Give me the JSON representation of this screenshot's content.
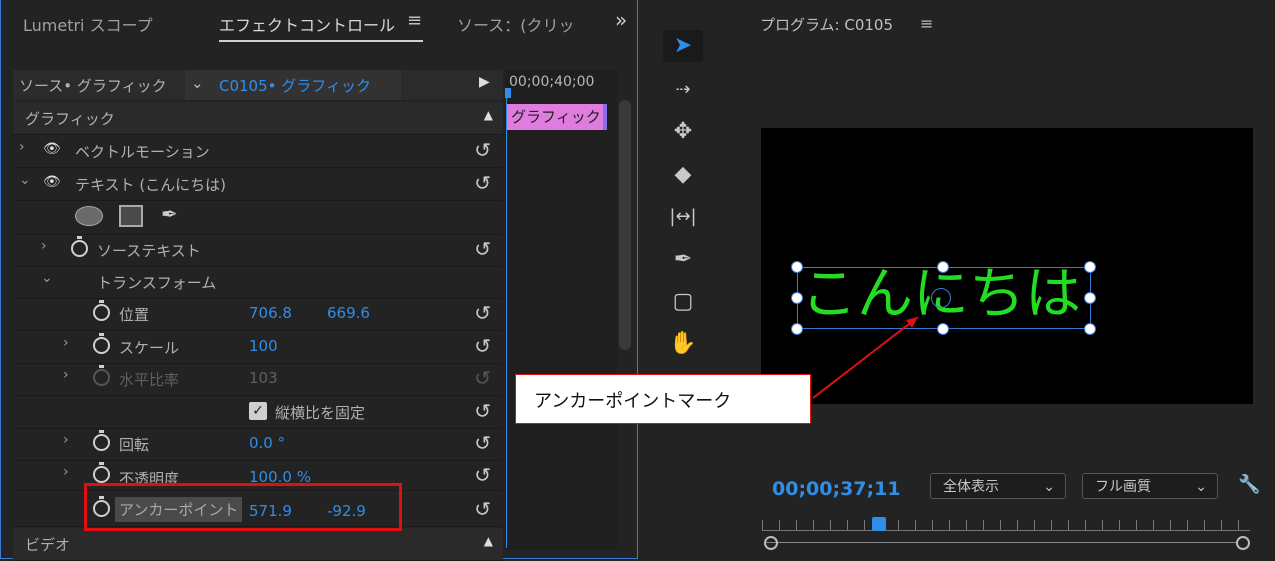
{
  "effect_panel": {
    "tabs": [
      "Lumetri スコープ",
      "エフェクトコントロール",
      "ソース：(クリッ"
    ],
    "menu_glyph": "≡",
    "overflow_glyph": "»",
    "source_label": "ソース• グラフィック",
    "clip_label": "C0105• グラフィック",
    "timecode": "00;00;40;00",
    "clip_bar_label": "グラフィック",
    "section_graphic": "グラフィック",
    "vector_motion": "ベクトルモーション",
    "text_layer": "テキスト (こんにちは)",
    "source_text": "ソーステキスト",
    "transform": "トランスフォーム",
    "position_label": "位置",
    "position_x": "706.8",
    "position_y": "669.6",
    "scale_label": "スケール",
    "scale_value": "100",
    "h_ratio_label": "水平比率",
    "h_ratio_value": "103",
    "lock_ratio_label": "縦横比を固定",
    "rotation_label": "回転",
    "rotation_value": "0.0 °",
    "opacity_label": "不透明度",
    "opacity_value": "100.0 %",
    "anchor_label": "アンカーポイント",
    "anchor_x": "571.9",
    "anchor_y": "-92.9",
    "video_section": "ビデオ"
  },
  "program_panel": {
    "title": "プログラム: C0105",
    "menu_glyph": "≡",
    "overlay_text": "こんにちは",
    "timecode": "00;00;37;11",
    "zoom_select": "全体表示",
    "quality_select": "フル画質"
  },
  "callout": {
    "text": "アンカーポイントマーク"
  },
  "tools": [
    "selection-tool",
    "track-select-tool",
    "ripple-edit-tool",
    "razor-tool",
    "slip-tool",
    "pen-tool",
    "rectangle-tool",
    "hand-tool"
  ],
  "colors": {
    "accent_blue": "#2f8ee8",
    "text_green": "#22dd22",
    "highlight_red": "#e01010",
    "clip_pink": "#e07be0"
  }
}
